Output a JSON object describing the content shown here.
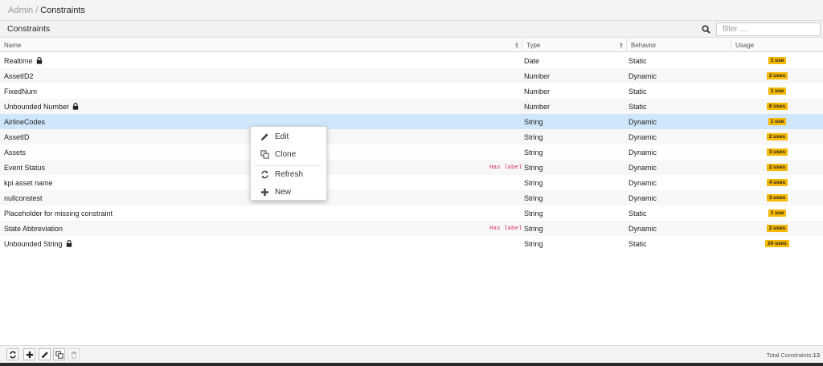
{
  "breadcrumb": {
    "parent": "Admin",
    "separator": "/",
    "current": "Constraints"
  },
  "panel": {
    "title": "Constraints",
    "filter_placeholder": "filter ..."
  },
  "columns": {
    "name": "Name",
    "type": "Type",
    "behavior": "Behavior",
    "usage": "Usage"
  },
  "rows": [
    {
      "name": "Realtime",
      "locked": true,
      "has_label": "",
      "type": "Date",
      "behavior": "Static",
      "usage": "1 use"
    },
    {
      "name": "AssetID2",
      "locked": false,
      "has_label": "",
      "type": "Number",
      "behavior": "Dynamic",
      "usage": "2 uses"
    },
    {
      "name": "FixedNum",
      "locked": false,
      "has_label": "",
      "type": "Number",
      "behavior": "Static",
      "usage": "1 use"
    },
    {
      "name": "Unbounded Number",
      "locked": true,
      "has_label": "",
      "type": "Number",
      "behavior": "Static",
      "usage": "8 uses"
    },
    {
      "name": "AirlineCodes",
      "locked": false,
      "has_label": "",
      "type": "String",
      "behavior": "Dynamic",
      "usage": "1 use",
      "selected": true
    },
    {
      "name": "AssetID",
      "locked": false,
      "has_label": "",
      "type": "String",
      "behavior": "Dynamic",
      "usage": "2 uses"
    },
    {
      "name": "Assets",
      "locked": false,
      "has_label": "",
      "type": "String",
      "behavior": "Dynamic",
      "usage": "3 uses"
    },
    {
      "name": "Event Status",
      "locked": false,
      "has_label": "Has label",
      "type": "String",
      "behavior": "Dynamic",
      "usage": "2 uses"
    },
    {
      "name": "kpi asset name",
      "locked": false,
      "has_label": "",
      "type": "String",
      "behavior": "Dynamic",
      "usage": "4 uses"
    },
    {
      "name": "nullconstest",
      "locked": false,
      "has_label": "",
      "type": "String",
      "behavior": "Dynamic",
      "usage": "3 uses"
    },
    {
      "name": "Placeholder for missing constraint",
      "locked": false,
      "has_label": "",
      "type": "String",
      "behavior": "Static",
      "usage": "1 use"
    },
    {
      "name": "State Abbreviation",
      "locked": false,
      "has_label": "Has label",
      "type": "String",
      "behavior": "Dynamic",
      "usage": "2 uses"
    },
    {
      "name": "Unbounded String",
      "locked": true,
      "has_label": "",
      "type": "String",
      "behavior": "Static",
      "usage": "24 uses"
    }
  ],
  "context_menu": {
    "edit": "Edit",
    "clone": "Clone",
    "refresh": "Refresh",
    "new": "New"
  },
  "footer": {
    "total_label": "Total Constraints:",
    "total_count": "13"
  },
  "colors": {
    "badge": "#f5b800",
    "selected_row": "#cfe6fb",
    "has_label": "#d6336c"
  }
}
